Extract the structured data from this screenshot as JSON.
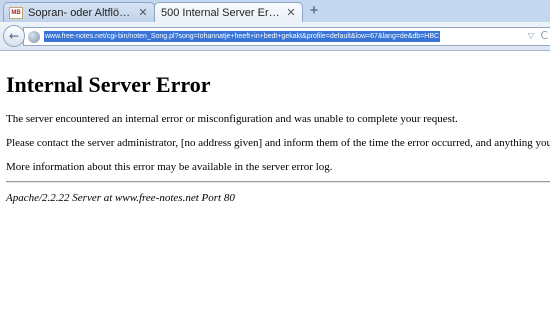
{
  "tabs": [
    {
      "title": "Sopran- oder Altflöte für B...",
      "favicon_text": "MB",
      "close": "✕"
    },
    {
      "title": "500 Internal Server Error",
      "close": "✕"
    }
  ],
  "new_tab_symbol": "+",
  "navigation": {
    "back_symbol": "←",
    "url": "www.free-notes.net/cgi-bin/noten_Song.pl?song=Iohannatje+heeft+in+bedt+gekakt&profile=default&low=67&lang=de&db=HBC",
    "dropdown_symbol": "▽",
    "reload_symbol": "C"
  },
  "page": {
    "title": "Internal Server Error",
    "paragraphs": [
      "The server encountered an internal error or misconfiguration and was unable to complete your request.",
      "Please contact the server administrator, [no address given] and inform them of the time the error occurred, and anything you",
      "More information about this error may be available in the server error log."
    ],
    "footer": "Apache/2.2.22 Server at www.free-notes.net Port 80"
  },
  "colors": {
    "tabstrip": "#c4d7ee",
    "url_highlight": "#3875d7"
  }
}
